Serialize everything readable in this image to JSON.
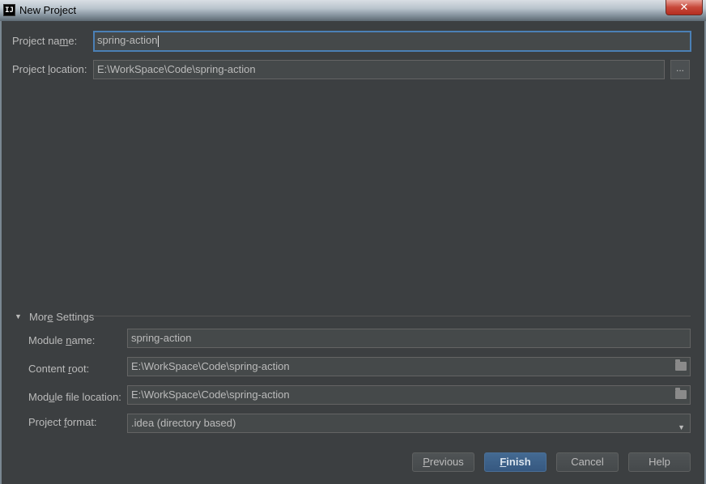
{
  "window": {
    "title": "New Project",
    "app_icon": "IJ",
    "close_glyph": "✕"
  },
  "form": {
    "project_name": {
      "label_pre": "Project na",
      "label_u": "m",
      "label_post": "e:",
      "value": "spring-action"
    },
    "project_location": {
      "label_pre": "Project ",
      "label_u": "l",
      "label_post": "ocation:",
      "value": "E:\\WorkSpace\\Code\\spring-action",
      "browse_label": "..."
    }
  },
  "more_settings": {
    "toggle_glyph": "▼",
    "label_pre": "Mor",
    "label_u": "e",
    "label_post": " Settings",
    "module_name": {
      "label_pre": "Module ",
      "label_u": "n",
      "label_post": "ame:",
      "value": "spring-action"
    },
    "content_root": {
      "label_pre": "Content ",
      "label_u": "r",
      "label_post": "oot:",
      "value": "E:\\WorkSpace\\Code\\spring-action"
    },
    "module_file_location": {
      "label_pre": "Mod",
      "label_u": "u",
      "label_post": "le file location:",
      "value": "E:\\WorkSpace\\Code\\spring-action"
    },
    "project_format": {
      "label_pre": "Project ",
      "label_u": "f",
      "label_post": "ormat:",
      "value": ".idea (directory based)",
      "arrow": "▼"
    }
  },
  "buttons": {
    "previous": {
      "u": "P",
      "rest": "revious"
    },
    "finish": {
      "u": "F",
      "rest": "inish"
    },
    "cancel": "Cancel",
    "help": "Help"
  },
  "colors": {
    "accent": "#4b80b6",
    "background": "#3c3f41",
    "primary_button": "#365880"
  }
}
